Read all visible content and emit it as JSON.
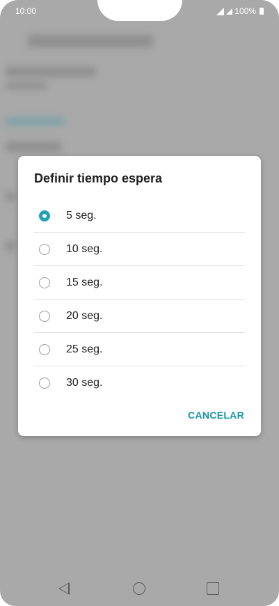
{
  "status_bar": {
    "time": "10:00",
    "battery": "100%"
  },
  "dialog": {
    "title": "Definir tiempo espera",
    "options": [
      {
        "label": "5 seg.",
        "selected": true
      },
      {
        "label": "10 seg.",
        "selected": false
      },
      {
        "label": "15 seg.",
        "selected": false
      },
      {
        "label": "20 seg.",
        "selected": false
      },
      {
        "label": "25 seg.",
        "selected": false
      },
      {
        "label": "30 seg.",
        "selected": false
      }
    ],
    "cancel_label": "CANCELAR"
  },
  "colors": {
    "accent": "#1ea3b6",
    "scrim": "#a9a9a9"
  },
  "nav_bar": {
    "icons": [
      "back-icon",
      "home-icon",
      "recents-icon"
    ]
  }
}
